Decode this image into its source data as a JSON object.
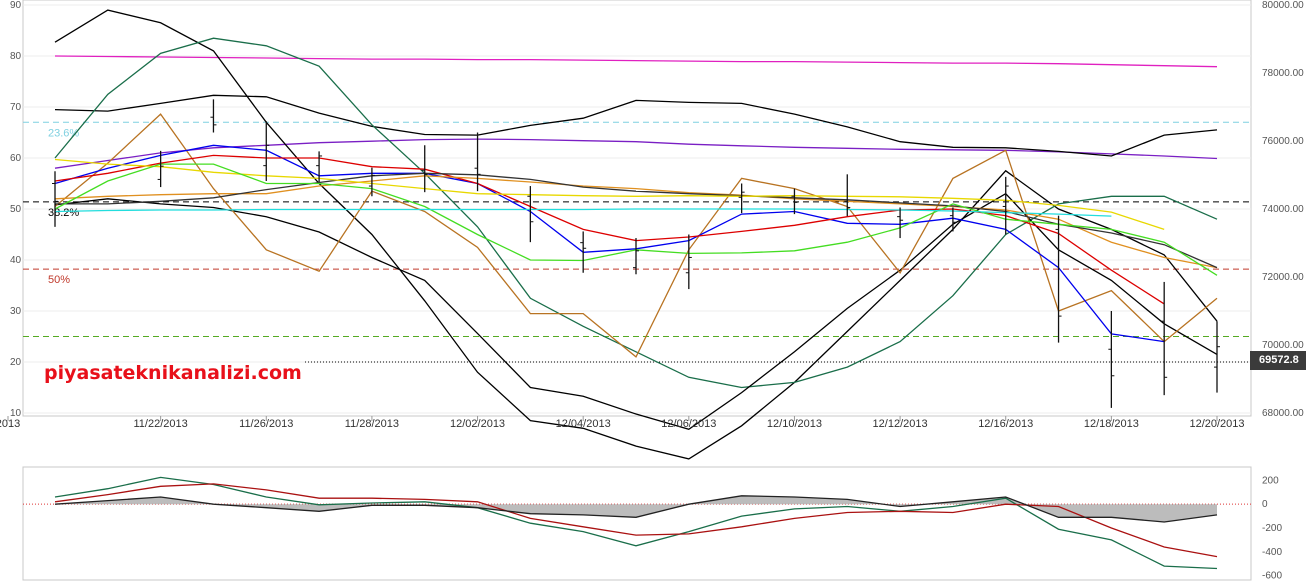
{
  "watermark": "piyasateknikanalizi.com",
  "price_label": "69572.8",
  "chart_data": [
    {
      "type": "line",
      "panel": "main",
      "x": [
        "11/20/2013",
        "11/21/2013",
        "11/22/2013",
        "11/25/2013",
        "11/26/2013",
        "11/27/2013",
        "11/28/2013",
        "11/29/2013",
        "12/02/2013",
        "12/03/2013",
        "12/04/2013",
        "12/05/2013",
        "12/06/2013",
        "12/09/2013",
        "12/10/2013",
        "12/11/2013",
        "12/12/2013",
        "12/13/2013",
        "12/16/2013",
        "12/17/2013",
        "12/18/2013",
        "12/19/2013",
        "12/20/2013"
      ],
      "x_tick_labels": [
        "2013",
        "11/22/2013",
        "11/26/2013",
        "11/28/2013",
        "12/02/2013",
        "12/04/2013",
        "12/06/2013",
        "12/10/2013",
        "12/12/2013",
        "12/16/2013",
        "12/18/2013",
        "12/20/2013"
      ],
      "left_axis": {
        "ylim": [
          10,
          90
        ],
        "ticks": [
          10,
          20,
          30,
          40,
          50,
          60,
          70,
          80,
          90
        ]
      },
      "right_axis": {
        "ylim": [
          68000,
          80000
        ],
        "ticks": [
          "68000.00",
          "70000.00",
          "72000.00",
          "74000.00",
          "76000.00",
          "78000.00",
          "80000.00"
        ]
      },
      "reference_lines": [
        {
          "label": "23.6%",
          "y": 67,
          "color": "#7fd0e0",
          "style": "dashed"
        },
        {
          "label": "38.2%",
          "y": 51.4,
          "color": "#000000",
          "style": "dashed"
        },
        {
          "label": "50%",
          "y": 38.2,
          "color": "#c0392b",
          "style": "dashed"
        },
        {
          "label": "",
          "y": 25,
          "color": "#55aa22",
          "style": "dashed"
        },
        {
          "label": "",
          "y": 20,
          "color": "#000000",
          "style": "dotted"
        }
      ],
      "series": [
        {
          "color": "#e020c0",
          "values": [
            80,
            79.9,
            79.8,
            79.7,
            79.6,
            79.5,
            79.4,
            79.4,
            79.3,
            79.3,
            79.2,
            79.1,
            79,
            78.9,
            78.9,
            78.8,
            78.7,
            78.6,
            78.6,
            78.5,
            78.3,
            78.1,
            77.9
          ]
        },
        {
          "color": "#7a1fc4",
          "values": [
            58,
            59.5,
            61,
            62,
            62.5,
            63,
            63.3,
            63.6,
            63.7,
            63.6,
            63.4,
            63.2,
            62.7,
            62.4,
            62.1,
            61.9,
            61.7,
            61.6,
            61.5,
            61.2,
            60.8,
            60.4,
            59.9
          ]
        },
        {
          "color": "#000000",
          "values": [
            69.5,
            69.2,
            70.7,
            72.3,
            72,
            68.8,
            66.2,
            64.6,
            64.5,
            66.4,
            67.8,
            71.3,
            70.9,
            70.7,
            68.6,
            66.1,
            63.2,
            62.1,
            62,
            61.3,
            60.4,
            64.5,
            65.5
          ]
        },
        {
          "color": "#000000",
          "values": [
            82.7,
            89,
            86.5,
            81,
            67,
            55,
            45,
            32,
            18,
            8.5,
            7,
            3.5,
            1,
            7.5,
            16,
            26,
            36,
            46,
            57.5,
            50,
            46,
            41,
            28
          ]
        },
        {
          "color": "#1a6e4a",
          "values": [
            60,
            72.5,
            80.5,
            83.5,
            82,
            78,
            66.5,
            57,
            46.5,
            32.5,
            27,
            22,
            17,
            15,
            16,
            19,
            24,
            33,
            45,
            51,
            52.5,
            52.5,
            48
          ]
        },
        {
          "color": "#000000",
          "values": [
            50.8,
            52,
            51,
            50.3,
            48.5,
            45.5,
            40.5,
            36,
            25.6,
            15,
            13.3,
            9.8,
            6.8,
            14,
            22,
            30.5,
            38,
            47,
            53,
            42,
            36,
            27.5,
            21.5
          ]
        },
        {
          "color": "#b87322",
          "values": [
            50.5,
            59,
            68.6,
            54,
            42,
            37.8,
            53.5,
            49.5,
            42.5,
            29.5,
            29.5,
            21,
            42,
            56,
            54,
            50.5,
            37.5,
            56,
            61.5,
            30,
            34,
            24,
            32.5
          ]
        },
        {
          "color": "#0000ee",
          "values": [
            55,
            58,
            60.5,
            62.5,
            61.5,
            56.5,
            57,
            57,
            55,
            49.5,
            41.5,
            42.2,
            43.8,
            49,
            49.5,
            47.2,
            47,
            48.2,
            46,
            38.5,
            25.5,
            24
          ]
        },
        {
          "color": "#dd0000",
          "values": [
            55.5,
            57,
            59,
            60.5,
            60,
            60,
            58.3,
            57.8,
            55,
            50.5,
            46,
            43.8,
            44.5,
            45.6,
            46.8,
            48.5,
            49.8,
            50,
            48.7,
            45.2,
            38,
            31.4
          ]
        },
        {
          "color": "#e09020",
          "values": [
            52,
            52.5,
            52.8,
            53,
            53,
            54.5,
            55.5,
            56.5,
            56,
            55.3,
            54.5,
            54,
            53.2,
            52.7,
            52,
            51.5,
            51,
            50.5,
            49.8,
            48,
            43.5,
            40.5,
            38.5
          ]
        },
        {
          "color": "#333333",
          "values": [
            51,
            51,
            51.5,
            52.2,
            53.8,
            55.2,
            56.5,
            57,
            56.7,
            55.8,
            54.3,
            53.5,
            53,
            52.6,
            52.2,
            51.8,
            51.2,
            50.6,
            49.5,
            47,
            45.3,
            43,
            38.5
          ]
        },
        {
          "color": "#e8d800",
          "values": [
            59.7,
            58.8,
            58.3,
            57.2,
            56.5,
            56,
            55,
            54,
            53,
            52.8,
            52.6,
            52.5,
            52.6,
            52.5,
            52.6,
            52.5,
            52.4,
            52.1,
            51.7,
            50.7,
            49.4,
            46
          ]
        },
        {
          "color": "#44dd22",
          "values": [
            50,
            55.5,
            58.8,
            58.8,
            55,
            55,
            54,
            50.5,
            45,
            40,
            39.9,
            42,
            41.3,
            41.4,
            41.8,
            43.5,
            46.3,
            51,
            48,
            47,
            46,
            43.5,
            37
          ]
        },
        {
          "color": "#22dddd",
          "values": [
            49.5,
            49.7,
            49.8,
            49.8,
            49.9,
            49.9,
            49.9,
            49.9,
            49.9,
            49.9,
            49.9,
            50,
            50,
            50,
            50,
            49.9,
            49.8,
            49.6,
            49.3,
            49,
            48.6
          ]
        }
      ],
      "candles": [
        {
          "x": "11/20/2013",
          "high": 57.4,
          "low": 46.5,
          "open": 55,
          "close": 51.5
        },
        {
          "x": "11/22/2013",
          "high": 61.4,
          "low": 54.3,
          "open": 55.8,
          "close": 58.4
        },
        {
          "x": "11/25/2013",
          "high": 71.5,
          "low": 65,
          "open": 68,
          "close": 66.5
        },
        {
          "x": "11/26/2013",
          "high": 67.2,
          "low": 55.5,
          "open": 58.5,
          "close": 62.5
        },
        {
          "x": "11/27/2013",
          "high": 61.3,
          "low": 55.3,
          "open": 58.5,
          "close": 60.4
        },
        {
          "x": "11/28/2013",
          "high": 58.1,
          "low": 52.5,
          "open": 54.5,
          "close": 56.6
        },
        {
          "x": "11/29/2013",
          "high": 62.5,
          "low": 53.3,
          "open": 57.6,
          "close": 56.8
        },
        {
          "x": "12/02/2013",
          "high": 65,
          "low": 53.5,
          "open": 58,
          "close": 56.8
        },
        {
          "x": "12/03/2013",
          "high": 54.5,
          "low": 43.5,
          "open": 52.5,
          "close": 47.5
        },
        {
          "x": "12/04/2013",
          "high": 45.6,
          "low": 37.5,
          "open": 43.4,
          "close": 42.3
        },
        {
          "x": "12/05/2013",
          "high": 44.3,
          "low": 37.2,
          "open": 38.5,
          "close": 41.8
        },
        {
          "x": "12/06/2013",
          "high": 45,
          "low": 34.3,
          "open": 37.5,
          "close": 40.5
        },
        {
          "x": "12/09/2013",
          "high": 55,
          "low": 49.2,
          "open": 52.3,
          "close": 53.3
        },
        {
          "x": "12/10/2013",
          "high": 54,
          "low": 49,
          "open": 52.5,
          "close": 51.3
        },
        {
          "x": "12/11/2013",
          "high": 56.8,
          "low": 48.6,
          "open": 51.5,
          "close": 50.3
        },
        {
          "x": "12/12/2013",
          "high": 50.3,
          "low": 44.3,
          "open": 48.5,
          "close": 47.8
        },
        {
          "x": "12/13/2013",
          "high": 50.3,
          "low": 45.6,
          "open": 48.7,
          "close": 47.4
        },
        {
          "x": "12/16/2013",
          "high": 56.3,
          "low": 45,
          "open": 50.5,
          "close": 54.5
        },
        {
          "x": "12/17/2013",
          "high": 48.7,
          "low": 23.8,
          "open": 46,
          "close": 29
        },
        {
          "x": "12/18/2013",
          "high": 30,
          "low": 11,
          "open": 22.5,
          "close": 17.3
        },
        {
          "x": "12/19/2013",
          "high": 35.7,
          "low": 13.5,
          "open": 28,
          "close": 17
        },
        {
          "x": "12/20/2013",
          "high": 28,
          "low": 14,
          "open": 19,
          "close": 23
        }
      ]
    },
    {
      "type": "line",
      "panel": "oscillator",
      "x": [
        "11/20/2013",
        "11/21/2013",
        "11/22/2013",
        "11/25/2013",
        "11/26/2013",
        "11/27/2013",
        "11/28/2013",
        "11/29/2013",
        "12/02/2013",
        "12/03/2013",
        "12/04/2013",
        "12/05/2013",
        "12/06/2013",
        "12/09/2013",
        "12/10/2013",
        "12/11/2013",
        "12/12/2013",
        "12/13/2013",
        "12/16/2013",
        "12/17/2013",
        "12/18/2013",
        "12/19/2013",
        "12/20/2013"
      ],
      "ylim": [
        -620,
        270
      ],
      "y_ticks": [
        "200",
        "0",
        "-200",
        "-400",
        "-600"
      ],
      "series": [
        {
          "color": "#1a6e4a",
          "values": [
            60,
            130,
            225,
            165,
            60,
            -5,
            10,
            20,
            -30,
            -160,
            -230,
            -350,
            -230,
            -100,
            -40,
            -20,
            -60,
            -20,
            50,
            -210,
            -300,
            -520,
            -540
          ]
        },
        {
          "color": "#aa1111",
          "values": [
            20,
            80,
            150,
            170,
            120,
            50,
            50,
            40,
            20,
            -120,
            -190,
            -260,
            -250,
            -190,
            -120,
            -70,
            -60,
            -70,
            0,
            -20,
            -200,
            -360,
            -440
          ]
        },
        {
          "color": "#222222",
          "values": [
            0,
            30,
            60,
            0,
            -30,
            -60,
            -10,
            -10,
            -30,
            -80,
            -90,
            -110,
            0,
            70,
            60,
            40,
            -20,
            20,
            60,
            -110,
            -110,
            -150,
            -90
          ]
        }
      ]
    }
  ]
}
